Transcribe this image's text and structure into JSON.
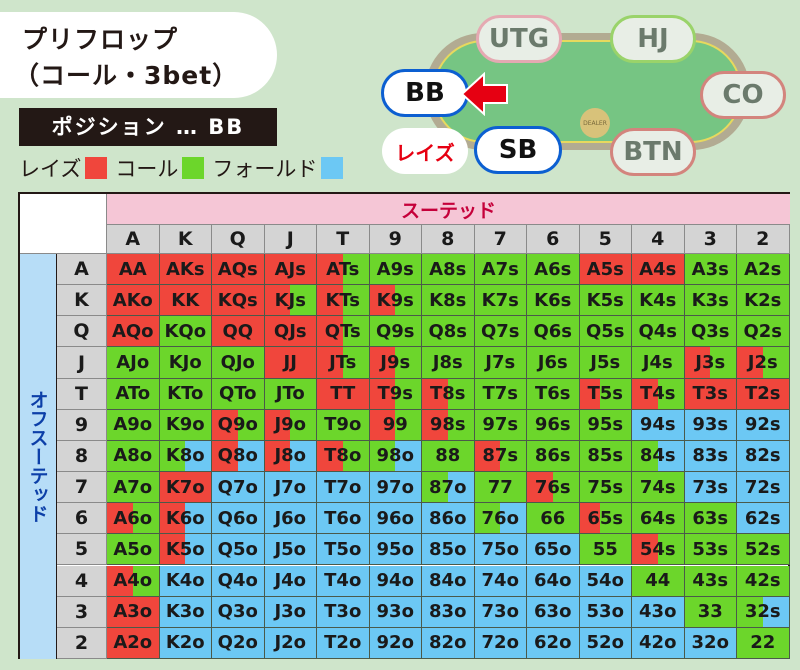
{
  "title": {
    "line1": "プリフロップ",
    "line2": "（コール・3bet）"
  },
  "position_bar": "ポジション … BB",
  "legend": [
    {
      "label": "レイズ",
      "color": "#f0463c"
    },
    {
      "label": "コール",
      "color": "#6cd62b"
    },
    {
      "label": "フォールド",
      "color": "#6cc8f4"
    }
  ],
  "table_seats": {
    "utg": "UTG",
    "hj": "HJ",
    "co": "CO",
    "btn": "BTN",
    "sb": "SB",
    "bb": "BB",
    "dealer": "DEALER",
    "sb_action": "レイズ"
  },
  "grid": {
    "suited_label": "スーテッド",
    "offsuit_label": "オフスーテッド",
    "ranks": [
      "A",
      "K",
      "Q",
      "J",
      "T",
      "9",
      "8",
      "7",
      "6",
      "5",
      "4",
      "3",
      "2"
    ],
    "colors": {
      "raise": "#f0463c",
      "call": "#6cd62b",
      "fold": "#6cc8f4"
    },
    "hands": [
      [
        "AA",
        "AKs",
        "AQs",
        "AJs",
        "ATs",
        "A9s",
        "A8s",
        "A7s",
        "A6s",
        "A5s",
        "A4s",
        "A3s",
        "A2s"
      ],
      [
        "AKo",
        "KK",
        "KQs",
        "KJs",
        "KTs",
        "K9s",
        "K8s",
        "K7s",
        "K6s",
        "K5s",
        "K4s",
        "K3s",
        "K2s"
      ],
      [
        "AQo",
        "KQo",
        "QQ",
        "QJs",
        "QTs",
        "Q9s",
        "Q8s",
        "Q7s",
        "Q6s",
        "Q5s",
        "Q4s",
        "Q3s",
        "Q2s"
      ],
      [
        "AJo",
        "KJo",
        "QJo",
        "JJ",
        "JTs",
        "J9s",
        "J8s",
        "J7s",
        "J6s",
        "J5s",
        "J4s",
        "J3s",
        "J2s"
      ],
      [
        "ATo",
        "KTo",
        "QTo",
        "JTo",
        "TT",
        "T9s",
        "T8s",
        "T7s",
        "T6s",
        "T5s",
        "T4s",
        "T3s",
        "T2s"
      ],
      [
        "A9o",
        "K9o",
        "Q9o",
        "J9o",
        "T9o",
        "99",
        "98s",
        "97s",
        "96s",
        "95s",
        "94s",
        "93s",
        "92s"
      ],
      [
        "A8o",
        "K8o",
        "Q8o",
        "J8o",
        "T8o",
        "98o",
        "88",
        "87s",
        "86s",
        "85s",
        "84s",
        "83s",
        "82s"
      ],
      [
        "A7o",
        "K7o",
        "Q7o",
        "J7o",
        "T7o",
        "97o",
        "87o",
        "77",
        "76s",
        "75s",
        "74s",
        "73s",
        "72s"
      ],
      [
        "A6o",
        "K6o",
        "Q6o",
        "J6o",
        "T6o",
        "96o",
        "86o",
        "76o",
        "66",
        "65s",
        "64s",
        "63s",
        "62s"
      ],
      [
        "A5o",
        "K5o",
        "Q5o",
        "J5o",
        "T5o",
        "95o",
        "85o",
        "75o",
        "65o",
        "55",
        "54s",
        "53s",
        "52s"
      ],
      [
        "A4o",
        "K4o",
        "Q4o",
        "J4o",
        "T4o",
        "94o",
        "84o",
        "74o",
        "64o",
        "54o",
        "44",
        "43s",
        "42s"
      ],
      [
        "A3o",
        "K3o",
        "Q3o",
        "J3o",
        "T3o",
        "93o",
        "83o",
        "73o",
        "63o",
        "53o",
        "43o",
        "33",
        "32s"
      ],
      [
        "A2o",
        "K2o",
        "Q2o",
        "J2o",
        "T2o",
        "92o",
        "82o",
        "72o",
        "62o",
        "52o",
        "42o",
        "32o",
        "22"
      ]
    ],
    "mix": [
      [
        [
          1,
          0,
          0
        ],
        [
          1,
          0,
          0
        ],
        [
          1,
          0,
          0
        ],
        [
          1,
          0,
          0
        ],
        [
          0.5,
          0.5,
          0
        ],
        [
          0,
          1,
          0
        ],
        [
          0,
          1,
          0
        ],
        [
          0,
          1,
          0
        ],
        [
          0,
          1,
          0
        ],
        [
          1,
          0,
          0
        ],
        [
          1,
          0,
          0
        ],
        [
          0,
          1,
          0
        ],
        [
          0,
          1,
          0
        ]
      ],
      [
        [
          1,
          0,
          0
        ],
        [
          1,
          0,
          0
        ],
        [
          1,
          0,
          0
        ],
        [
          0.5,
          0.5,
          0
        ],
        [
          0.5,
          0.5,
          0
        ],
        [
          0.5,
          0.5,
          0
        ],
        [
          0,
          1,
          0
        ],
        [
          0,
          1,
          0
        ],
        [
          0,
          1,
          0
        ],
        [
          0,
          1,
          0
        ],
        [
          0,
          1,
          0
        ],
        [
          0,
          1,
          0
        ],
        [
          0,
          1,
          0
        ]
      ],
      [
        [
          1,
          0,
          0
        ],
        [
          0,
          1,
          0
        ],
        [
          1,
          0,
          0
        ],
        [
          1,
          0,
          0
        ],
        [
          0.5,
          0.5,
          0
        ],
        [
          0,
          1,
          0
        ],
        [
          0,
          1,
          0
        ],
        [
          0,
          1,
          0
        ],
        [
          0,
          1,
          0
        ],
        [
          0,
          1,
          0
        ],
        [
          0,
          1,
          0
        ],
        [
          0,
          1,
          0
        ],
        [
          0,
          1,
          0
        ]
      ],
      [
        [
          0,
          1,
          0
        ],
        [
          0,
          1,
          0
        ],
        [
          0,
          1,
          0
        ],
        [
          1,
          0,
          0
        ],
        [
          0.5,
          0.5,
          0
        ],
        [
          0.5,
          0.5,
          0
        ],
        [
          0,
          1,
          0
        ],
        [
          0,
          1,
          0
        ],
        [
          0,
          1,
          0
        ],
        [
          0,
          1,
          0
        ],
        [
          0,
          1,
          0
        ],
        [
          0.5,
          0.5,
          0
        ],
        [
          0.5,
          0.5,
          0
        ]
      ],
      [
        [
          0,
          1,
          0
        ],
        [
          0,
          1,
          0
        ],
        [
          0,
          1,
          0
        ],
        [
          0,
          1,
          0
        ],
        [
          1,
          0,
          0
        ],
        [
          0.5,
          0.5,
          0
        ],
        [
          0.5,
          0.5,
          0
        ],
        [
          0,
          1,
          0
        ],
        [
          0,
          1,
          0
        ],
        [
          0.4,
          0.6,
          0
        ],
        [
          0.5,
          0.5,
          0
        ],
        [
          1,
          0,
          0
        ],
        [
          1,
          0,
          0
        ]
      ],
      [
        [
          0,
          1,
          0
        ],
        [
          0,
          1,
          0
        ],
        [
          0.5,
          0.5,
          0
        ],
        [
          0.5,
          0.5,
          0
        ],
        [
          0,
          1,
          0
        ],
        [
          0.5,
          0.5,
          0
        ],
        [
          0.5,
          0.5,
          0
        ],
        [
          0,
          1,
          0
        ],
        [
          0,
          1,
          0
        ],
        [
          0,
          1,
          0
        ],
        [
          0,
          0,
          1
        ],
        [
          0,
          0,
          1
        ],
        [
          0,
          0,
          1
        ]
      ],
      [
        [
          0,
          1,
          0
        ],
        [
          0,
          0.5,
          0.5
        ],
        [
          0.5,
          0,
          0.5
        ],
        [
          0.5,
          0,
          0.5
        ],
        [
          0.5,
          0.5,
          0
        ],
        [
          0,
          0.5,
          0.5
        ],
        [
          0,
          1,
          0
        ],
        [
          0.5,
          0.5,
          0
        ],
        [
          0,
          1,
          0
        ],
        [
          0,
          1,
          0
        ],
        [
          0,
          0.5,
          0.5
        ],
        [
          0,
          0,
          1
        ],
        [
          0,
          0,
          1
        ]
      ],
      [
        [
          0,
          1,
          0
        ],
        [
          1,
          0,
          0
        ],
        [
          0,
          0,
          1
        ],
        [
          0,
          0,
          1
        ],
        [
          0,
          0,
          1
        ],
        [
          0,
          0,
          1
        ],
        [
          0,
          0.5,
          0.5
        ],
        [
          0,
          1,
          0
        ],
        [
          0.5,
          0.5,
          0
        ],
        [
          0,
          1,
          0
        ],
        [
          0,
          1,
          0
        ],
        [
          0,
          0,
          1
        ],
        [
          0,
          0,
          1
        ]
      ],
      [
        [
          0.5,
          0.5,
          0
        ],
        [
          0.5,
          0,
          0.5
        ],
        [
          0,
          0,
          1
        ],
        [
          0,
          0,
          1
        ],
        [
          0,
          0,
          1
        ],
        [
          0,
          0,
          1
        ],
        [
          0,
          0,
          1
        ],
        [
          0,
          0.5,
          0.5
        ],
        [
          0,
          1,
          0
        ],
        [
          0.4,
          0.6,
          0
        ],
        [
          0,
          1,
          0
        ],
        [
          0,
          1,
          0
        ],
        [
          0,
          0,
          1
        ]
      ],
      [
        [
          0,
          1,
          0
        ],
        [
          0.5,
          0,
          0.5
        ],
        [
          0,
          0,
          1
        ],
        [
          0,
          0,
          1
        ],
        [
          0,
          0,
          1
        ],
        [
          0,
          0,
          1
        ],
        [
          0,
          0,
          1
        ],
        [
          0,
          0,
          1
        ],
        [
          0,
          0,
          1
        ],
        [
          0,
          1,
          0
        ],
        [
          0.5,
          0.5,
          0
        ],
        [
          0,
          1,
          0
        ],
        [
          0,
          1,
          0
        ]
      ],
      [
        [
          0.5,
          0.5,
          0
        ],
        [
          0,
          0,
          1
        ],
        [
          0,
          0,
          1
        ],
        [
          0,
          0,
          1
        ],
        [
          0,
          0,
          1
        ],
        [
          0,
          0,
          1
        ],
        [
          0,
          0,
          1
        ],
        [
          0,
          0,
          1
        ],
        [
          0,
          0,
          1
        ],
        [
          0,
          0,
          1
        ],
        [
          0,
          1,
          0
        ],
        [
          0,
          1,
          0
        ],
        [
          0,
          1,
          0
        ]
      ],
      [
        [
          1,
          0,
          0
        ],
        [
          0,
          0,
          1
        ],
        [
          0,
          0,
          1
        ],
        [
          0,
          0,
          1
        ],
        [
          0,
          0,
          1
        ],
        [
          0,
          0,
          1
        ],
        [
          0,
          0,
          1
        ],
        [
          0,
          0,
          1
        ],
        [
          0,
          0,
          1
        ],
        [
          0,
          0,
          1
        ],
        [
          0,
          0,
          1
        ],
        [
          0,
          1,
          0
        ],
        [
          0,
          0.5,
          0.5
        ]
      ],
      [
        [
          1,
          0,
          0
        ],
        [
          0,
          0,
          1
        ],
        [
          0,
          0,
          1
        ],
        [
          0,
          0,
          1
        ],
        [
          0,
          0,
          1
        ],
        [
          0,
          0,
          1
        ],
        [
          0,
          0,
          1
        ],
        [
          0,
          0,
          1
        ],
        [
          0,
          0,
          1
        ],
        [
          0,
          0,
          1
        ],
        [
          0,
          0,
          1
        ],
        [
          0,
          0,
          1
        ],
        [
          0,
          1,
          0
        ]
      ]
    ]
  }
}
